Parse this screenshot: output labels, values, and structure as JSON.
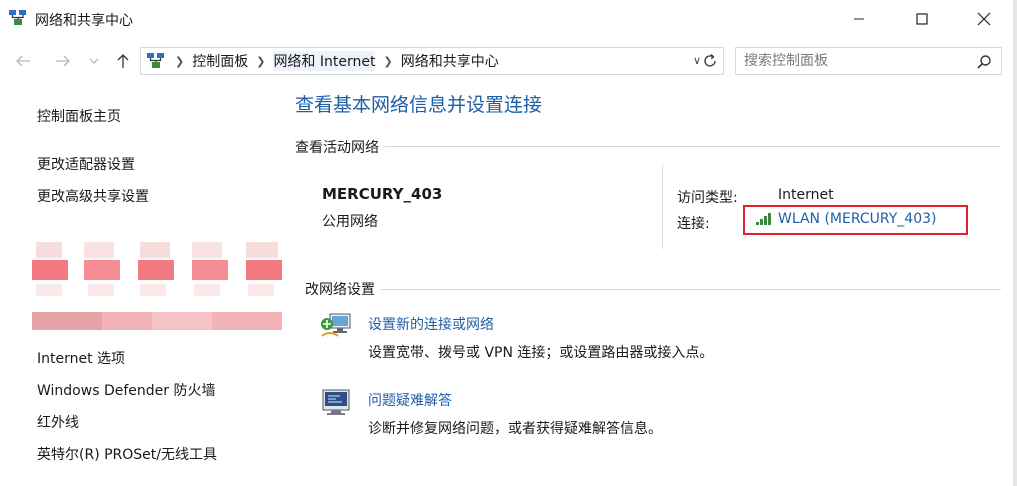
{
  "window": {
    "title": "网络和共享中心",
    "buttons": [
      "minimize",
      "maximize",
      "close"
    ]
  },
  "navigation": {
    "breadcrumbs": [
      "控制面板",
      "网络和 Internet",
      "网络和共享中心"
    ],
    "search_placeholder": "搜索控制面板"
  },
  "left_pane": {
    "home": "控制面板主页",
    "links": [
      "更改适配器设置",
      "更改高级共享设置"
    ],
    "see_also": [
      "Internet 选项",
      "Windows Defender 防火墙",
      "红外线",
      "英特尔(R) PROSet/无线工具"
    ]
  },
  "main": {
    "title": "查看基本网络信息并设置连接",
    "active_networks_label": "查看活动网络",
    "network": {
      "name": "MERCURY_403",
      "category": "公用网络",
      "access_type_key": "访问类型:",
      "access_type_value": "Internet",
      "connection_key": "连接:",
      "connection_value": "WLAN (MERCURY_403)"
    },
    "change_settings_label": "更改网络设置",
    "change_settings_label_visible": "改网络设置",
    "tasks": [
      {
        "title": "设置新的连接或网络",
        "description": "设置宽带、拨号或 VPN 连接；或设置路由器或接入点。",
        "icon": "network-setup-icon"
      },
      {
        "title": "问题疑难解答",
        "description": "诊断并修复网络问题，或者获得疑难解答信息。",
        "icon": "troubleshoot-icon"
      }
    ]
  },
  "colors": {
    "link": "#1e5fa8",
    "highlight_box": "#e0202a",
    "divider": "#d9d9d9"
  }
}
